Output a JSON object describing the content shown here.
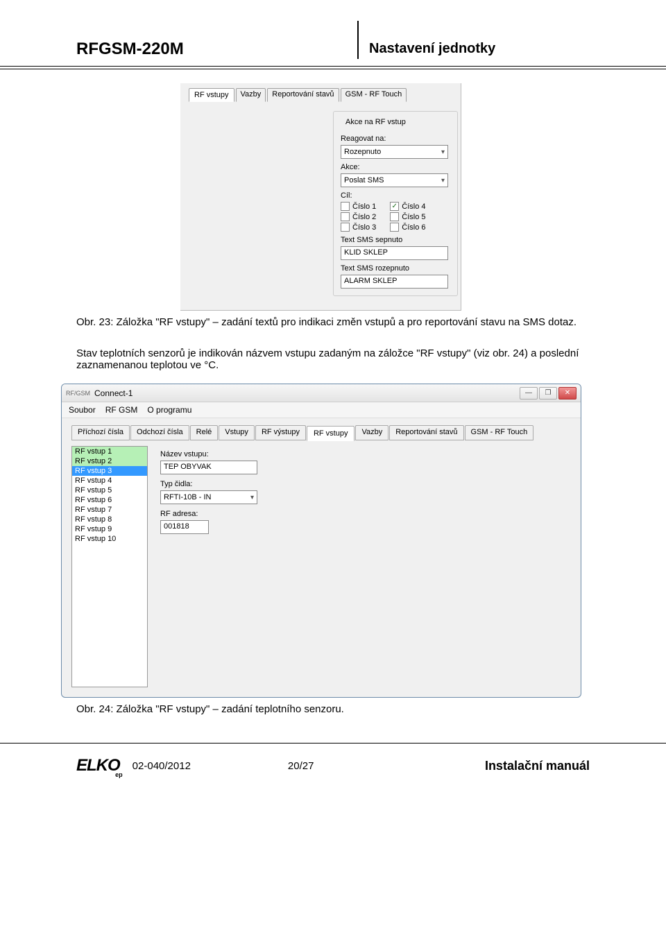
{
  "header": {
    "left": "RFGSM-220M",
    "right": "Nastavení jednotky"
  },
  "fig1": {
    "tabs": [
      "RF vstupy",
      "Vazby",
      "Reportování stavů",
      "GSM - RF Touch"
    ],
    "activeTab": 0,
    "groupTitle": "Akce na RF vstup",
    "lblReagovat": "Reagovat na:",
    "drop1": "Rozepnuto",
    "lblAkce": "Akce:",
    "drop2": "Poslat SMS",
    "lblCil": "Cíl:",
    "chk": {
      "c1": "Číslo 1",
      "c1v": false,
      "c4": "Číslo 4",
      "c4v": true,
      "c2": "Číslo 2",
      "c2v": false,
      "c5": "Číslo 5",
      "c5v": false,
      "c3": "Číslo 3",
      "c3v": false,
      "c6": "Číslo 6",
      "c6v": false
    },
    "lblSep": "Text SMS sepnuto",
    "txtSep": "KLID SKLEP",
    "lblRoz": "Text SMS rozepnuto",
    "txtRoz": "ALARM SKLEP"
  },
  "caption1": "Obr. 23: Záložka \"RF vstupy\" – zadání textů pro indikaci změn vstupů a pro reportování stavu na SMS dotaz.",
  "para1": "Stav teplotních senzorů je indikován názvem vstupu zadaným na záložce \"RF vstupy\" (viz obr. 24) a poslední zaznamenanou teplotou ve °C.",
  "fig2": {
    "titleIcon": "RF/GSM",
    "title": "Connect-1",
    "menu": [
      "Soubor",
      "RF GSM",
      "O programu"
    ],
    "tabs": [
      "Příchozí čísla",
      "Odchozí čísla",
      "Relé",
      "Vstupy",
      "RF výstupy",
      "RF vstupy",
      "Vazby",
      "Reportování stavů",
      "GSM - RF Touch"
    ],
    "activeTab": 5,
    "list": [
      "RF vstup 1",
      "RF vstup 2",
      "RF vstup 3",
      "RF vstup 4",
      "RF vstup 5",
      "RF vstup 6",
      "RF vstup 7",
      "RF vstup 8",
      "RF vstup 9",
      "RF vstup 10"
    ],
    "listSelected": 2,
    "greenIdx": [
      0,
      1,
      2
    ],
    "lblNazev": "Název vstupu:",
    "valNazev": "TEP OBYVAK",
    "lblTyp": "Typ čidla:",
    "valTyp": "RFTI-10B - IN",
    "lblAdr": "RF adresa:",
    "valAdr": "001818"
  },
  "caption2": "Obr. 24: Záložka \"RF vstupy\" – zadání teplotního senzoru.",
  "footer": {
    "logo": "ELKO",
    "logoSub": "ep",
    "code": "02-040/2012",
    "page": "20/27",
    "manual": "Instalační manuál"
  }
}
